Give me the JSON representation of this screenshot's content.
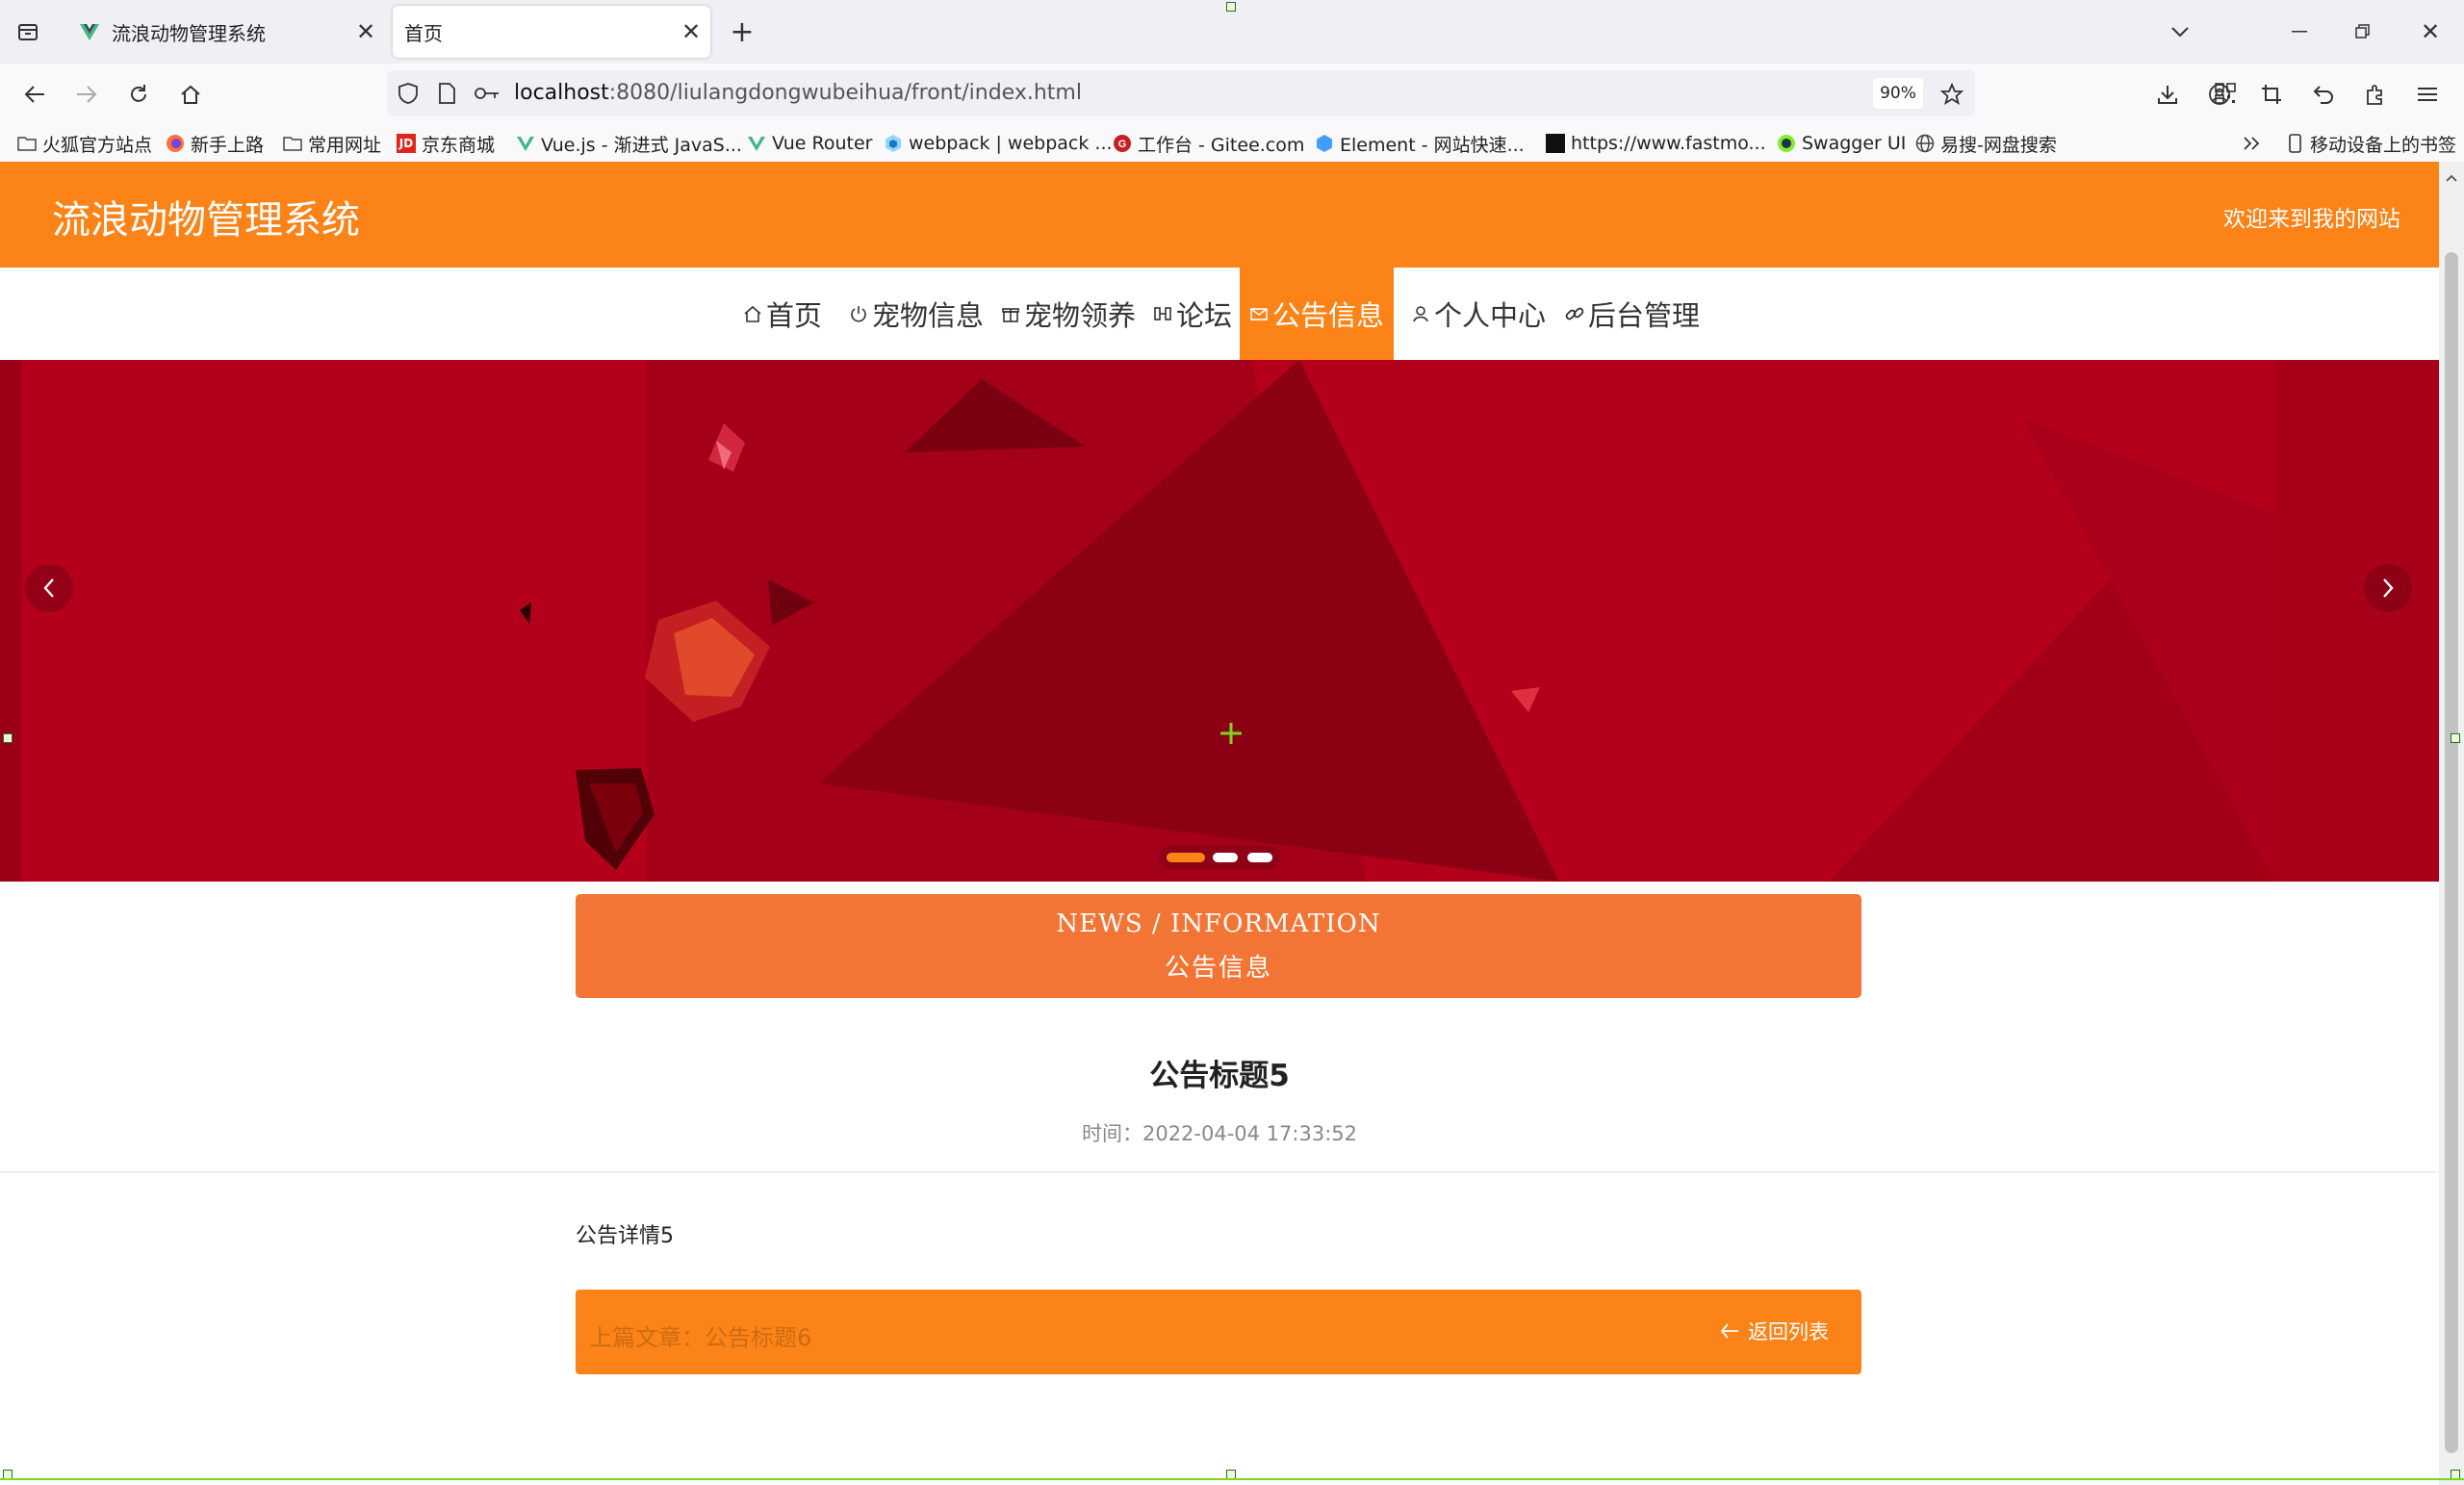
{
  "browser": {
    "tabs": [
      {
        "title": "流浪动物管理系统",
        "active": false
      },
      {
        "title": "首页",
        "active": true
      }
    ],
    "url_host": "localhost",
    "url_rest": ":8080/liulangdongwubeihua/front/index.html",
    "zoom": "90%",
    "bookmarks": [
      "火狐官方站点",
      "新手上路",
      "常用网址",
      "京东商城",
      "Vue.js - 渐进式 JavaS...",
      "Vue Router",
      "webpack | webpack ...",
      "工作台 - Gitee.com",
      "Element - 网站快速...",
      "https://www.fastmo...",
      "Swagger UI",
      "易搜-网盘搜索"
    ],
    "mobile_bookmarks": "移动设备上的书签"
  },
  "site": {
    "title": "流浪动物管理系统",
    "welcome": "欢迎来到我的网站",
    "accent": "#fb8318"
  },
  "menu": [
    {
      "label": "首页",
      "icon": "home-icon"
    },
    {
      "label": "宠物信息",
      "icon": "power-icon"
    },
    {
      "label": "宠物领养",
      "icon": "gift-icon"
    },
    {
      "label": "论坛",
      "icon": "film-icon"
    },
    {
      "label": "公告信息",
      "icon": "mail-icon",
      "active": true
    },
    {
      "label": "个人中心",
      "icon": "user-icon"
    },
    {
      "label": "后台管理",
      "icon": "link-icon"
    }
  ],
  "carousel": {
    "slides": 3,
    "active_index": 0
  },
  "news": {
    "en": "NEWS / INFORMATION",
    "cn": "公告信息"
  },
  "article": {
    "title": "公告标题5",
    "time_label": "时间：",
    "time": "2022-04-04 17:33:52",
    "content": "公告详情5"
  },
  "pager": {
    "prev": "上篇文章：公告标题6",
    "back": "返回列表"
  }
}
